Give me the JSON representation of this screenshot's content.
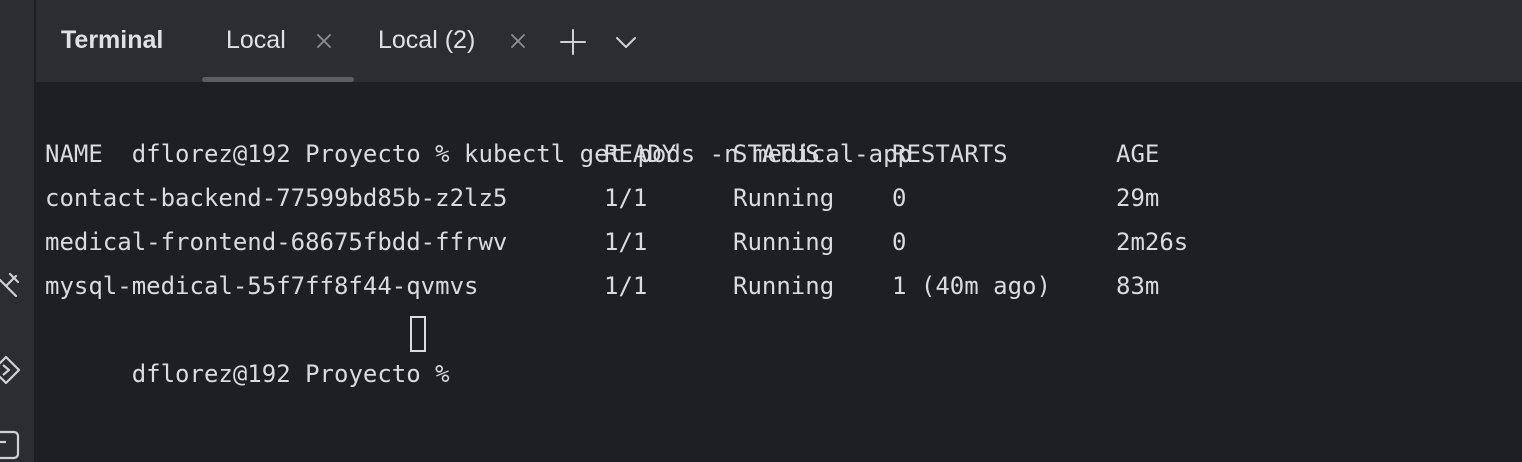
{
  "panel": {
    "title": "Terminal",
    "tabs": [
      {
        "label": "Local"
      },
      {
        "label": "Local (2)"
      }
    ]
  },
  "terminal": {
    "command_prompt": "dflorez@192 Proyecto % ",
    "command": "kubectl get pods -n medical-app",
    "headers": [
      "NAME",
      "READY",
      "STATUS",
      "RESTARTS",
      "AGE"
    ],
    "rows": [
      [
        "contact-backend-77599bd85b-z2lz5",
        "1/1",
        "Running",
        "0",
        "29m"
      ],
      [
        "medical-frontend-68675fbdd-ffrwv",
        "1/1",
        "Running",
        "0",
        "2m26s"
      ],
      [
        "mysql-medical-55f7ff8f44-qvmvs",
        "1/1",
        "Running",
        "1 (40m ago)",
        "83m"
      ]
    ],
    "final_prompt": "dflorez@192 Proyecto % "
  }
}
